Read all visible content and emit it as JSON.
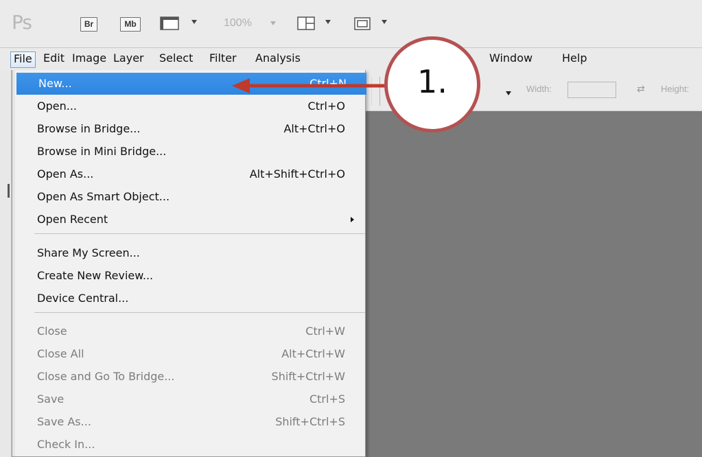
{
  "app": {
    "logo_text": "Ps",
    "bridge_label": "Br",
    "mini_bridge_label": "Mb",
    "zoom": "100%"
  },
  "menubar": {
    "items": [
      "File",
      "Edit",
      "Image",
      "Layer",
      "Select",
      "Filter",
      "Analysis",
      "Window",
      "Help"
    ],
    "active": "File"
  },
  "options_bar": {
    "width_label": "Width:",
    "height_label": "Height:"
  },
  "file_menu": {
    "items": [
      {
        "label": "New...",
        "shortcut": "Ctrl+N",
        "enabled": true,
        "highlighted": true
      },
      {
        "label": "Open...",
        "shortcut": "Ctrl+O",
        "enabled": true
      },
      {
        "label": "Browse in Bridge...",
        "shortcut": "Alt+Ctrl+O",
        "enabled": true
      },
      {
        "label": "Browse in Mini Bridge...",
        "shortcut": "",
        "enabled": true
      },
      {
        "label": "Open As...",
        "shortcut": "Alt+Shift+Ctrl+O",
        "enabled": true
      },
      {
        "label": "Open As Smart Object...",
        "shortcut": "",
        "enabled": true
      },
      {
        "label": "Open Recent",
        "shortcut": "",
        "enabled": true,
        "submenu": true
      },
      {
        "label": "Share My Screen...",
        "shortcut": "",
        "enabled": true
      },
      {
        "label": "Create New Review...",
        "shortcut": "",
        "enabled": true
      },
      {
        "label": "Device Central...",
        "shortcut": "",
        "enabled": true
      },
      {
        "label": "Close",
        "shortcut": "Ctrl+W",
        "enabled": false
      },
      {
        "label": "Close All",
        "shortcut": "Alt+Ctrl+W",
        "enabled": false
      },
      {
        "label": "Close and Go To Bridge...",
        "shortcut": "Shift+Ctrl+W",
        "enabled": false
      },
      {
        "label": "Save",
        "shortcut": "Ctrl+S",
        "enabled": false
      },
      {
        "label": "Save As...",
        "shortcut": "Shift+Ctrl+S",
        "enabled": false
      },
      {
        "label": "Check In...",
        "shortcut": "",
        "enabled": false
      }
    ]
  },
  "annotation": {
    "callout_text": "1.",
    "color": "#c0392b"
  },
  "colors": {
    "highlight": "#3a8fe6",
    "canvas": "#7a7a7a",
    "callout_border": "#b55151"
  }
}
